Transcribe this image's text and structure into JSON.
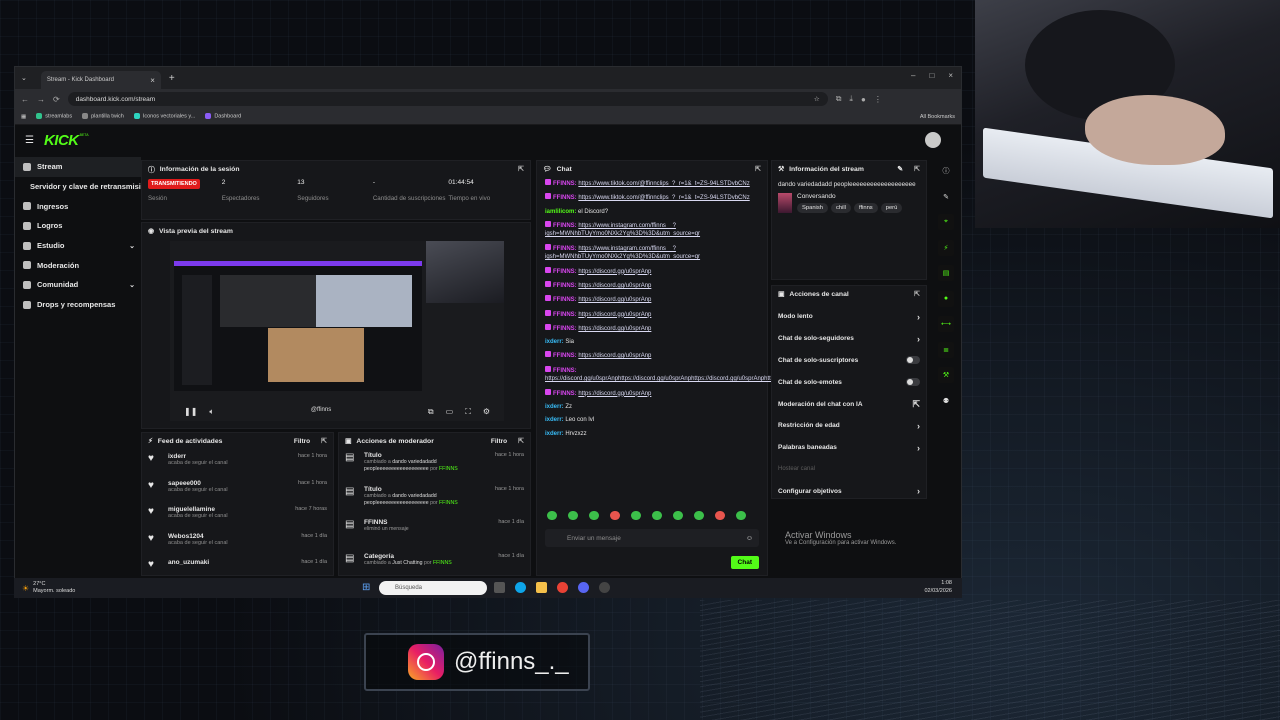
{
  "browser": {
    "tab_title": "Stream - Kick Dashboard",
    "url": "dashboard.kick.com/stream",
    "bookmarks": [
      "streamlabs",
      "plantilla twich",
      "Iconos vectoriales y...",
      "Dashboard"
    ],
    "all_bookmarks": "All Bookmarks"
  },
  "app": {
    "logo": "KICK",
    "logo_beta": "BETA"
  },
  "sidebar": {
    "items": [
      {
        "label": "Stream"
      },
      {
        "label": "Servidor y clave de retransmisión"
      },
      {
        "label": "Ingresos"
      },
      {
        "label": "Logros"
      },
      {
        "label": "Estudio"
      },
      {
        "label": "Moderación"
      },
      {
        "label": "Comunidad"
      },
      {
        "label": "Drops y recompensas"
      }
    ]
  },
  "session": {
    "title": "Información de la sesión",
    "status": "TRANSMITIENDO",
    "stats": [
      {
        "value": "",
        "label": "Sesión"
      },
      {
        "value": "2",
        "label": "Espectadores"
      },
      {
        "value": "13",
        "label": "Seguidores"
      },
      {
        "value": "-",
        "label": "Cantidad de suscripciones"
      },
      {
        "value": "01:44:54",
        "label": "Tiempo en vivo"
      }
    ]
  },
  "preview": {
    "title": "Vista previa del stream",
    "tag": "@ffinns"
  },
  "feed": {
    "title": "Feed de actividades",
    "filter": "Filtro",
    "items": [
      {
        "name": "ixderr",
        "sub": "acaba de seguir el canal",
        "time": "hace 1 hora"
      },
      {
        "name": "sapeee000",
        "sub": "acaba de seguir el canal",
        "time": "hace 1 hora"
      },
      {
        "name": "miguelellamine",
        "sub": "acaba de seguir el canal",
        "time": "hace 7 horas"
      },
      {
        "name": "Webos1204",
        "sub": "acaba de seguir el canal",
        "time": "hace 1 día"
      },
      {
        "name": "ano_uzumaki",
        "sub": "",
        "time": "hace 1 día"
      }
    ]
  },
  "mod": {
    "title": "Acciones de moderador",
    "filter": "Filtro",
    "items": [
      {
        "title": "Título",
        "pre": "cambiado a ",
        "val": "dando variedadadd peopleeeeeeeeeeeeeeeeee",
        "by": " por ",
        "who": "FFINNS",
        "time": "hace 1 hora"
      },
      {
        "title": "Título",
        "pre": "cambiado a ",
        "val": "dando variedadadd peopleeeeeeeeeeeeeeeeee",
        "by": " por ",
        "who": "FFINNS",
        "time": "hace 1 hora"
      },
      {
        "title": "FFINNS",
        "pre": "eliminó un mensaje",
        "val": "",
        "by": "",
        "who": "",
        "time": "hace 1 día"
      },
      {
        "title": "Categoría",
        "pre": "cambiado a ",
        "val": "Just Chatting",
        "by": " por ",
        "who": "FFINNS",
        "time": "hace 1 día"
      }
    ]
  },
  "chat": {
    "title": "Chat",
    "placeholder": "Enviar un mensaje",
    "send": "Chat",
    "messages": [
      {
        "user": "FFINNS:",
        "text": "https://www.tiktok.com/@ffinnclips_?_r=1&_t=ZS-94LSTDvbCNz",
        "type": "link"
      },
      {
        "user": "FFINNS:",
        "text": "https://www.tiktok.com/@ffinnclips_?_r=1&_t=ZS-94LSTDvbCNz",
        "type": "link"
      },
      {
        "user": "iamlilicom:",
        "text": "el Discord?",
        "type": "text",
        "c": "u3"
      },
      {
        "user": "FFINNS:",
        "text": "https://www.instagram.com/ffinns__?igsh=MWNhbTUyYmo0NXk2Yg%3D%3D&utm_source=qr",
        "type": "link"
      },
      {
        "user": "FFINNS:",
        "text": "https://www.instagram.com/ffinns__?igsh=MWNhbTUyYmo0NXk2Yg%3D%3D&utm_source=qr",
        "type": "link"
      },
      {
        "user": "FFINNS:",
        "text": "https://discord.gg/u0sprAnp",
        "type": "link"
      },
      {
        "user": "FFINNS:",
        "text": "https://discord.gg/u0sprAnp",
        "type": "link"
      },
      {
        "user": "FFINNS:",
        "text": "https://discord.gg/u0sprAnp",
        "type": "link"
      },
      {
        "user": "FFINNS:",
        "text": "https://discord.gg/u0sprAnp",
        "type": "link"
      },
      {
        "user": "FFINNS:",
        "text": "https://discord.gg/u0sprAnp",
        "type": "link"
      },
      {
        "user": "ixderr:",
        "text": "Sia",
        "type": "text",
        "c": "u2"
      },
      {
        "user": "FFINNS:",
        "text": "https://discord.gg/u0sprAnp",
        "type": "link"
      },
      {
        "user": "FFINNS:",
        "text": "https://discord.gg/u0sprAnphttps://discord.gg/u0sprAnphttps://discord.gg/u0sprAnphttps://discord.gg/u0sprAnphttps://discord.gg/u0sprAnp",
        "type": "link"
      },
      {
        "user": "FFINNS:",
        "text": "https://discord.gg/u0sprAnp",
        "type": "link"
      },
      {
        "user": "ixderr:",
        "text": "Zz",
        "type": "text",
        "c": "u2"
      },
      {
        "user": "ixderr:",
        "text": "Leo con lvl",
        "type": "text",
        "c": "u2"
      },
      {
        "user": "ixderr:",
        "text": "Hrvzxzz",
        "type": "text",
        "c": "u2"
      }
    ]
  },
  "streaminfo": {
    "title": "Información del stream",
    "stream_title": "dando variedadadd peopleeeeeeeeeeeeeeeeeee",
    "category": "Conversando",
    "tags": [
      "Spanish",
      "chill",
      "ffinns",
      "perú"
    ]
  },
  "actions": {
    "title": "Acciones de canal",
    "items": [
      {
        "label": "Modo lento",
        "kind": "arrow"
      },
      {
        "label": "Chat de solo-seguidores",
        "kind": "arrow"
      },
      {
        "label": "Chat de solo-suscriptores",
        "kind": "toggle"
      },
      {
        "label": "Chat de solo-emotes",
        "kind": "toggle"
      },
      {
        "label": "Moderación del chat con IA",
        "kind": "ext"
      },
      {
        "label": "Restricción de edad",
        "kind": "arrow"
      },
      {
        "label": "Palabras baneadas",
        "kind": "arrow"
      },
      {
        "label": "Hostear canal",
        "kind": "dim"
      },
      {
        "label": "Configurar objetivos",
        "kind": "arrow"
      }
    ]
  },
  "windows": {
    "activate_title": "Activar Windows",
    "activate_sub": "Ve a Configuración para activar Windows.",
    "temp": "27°C",
    "weather": "Mayorm. soleado",
    "search": "Búsqueda",
    "time": "1:08",
    "date": "02/03/2026"
  },
  "overlay": {
    "handle": "@ffinns_._"
  }
}
